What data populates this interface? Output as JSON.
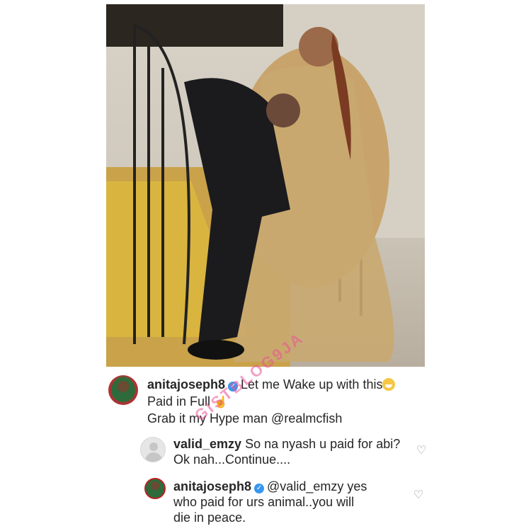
{
  "post": {
    "username": "anitajoseph8",
    "caption_line1": "Let me Wake up with this",
    "caption_line2": "Paid in Full",
    "caption_line3": "Grab it my Hype man @realmcfish"
  },
  "comments": [
    {
      "username": "valid_emzy",
      "text_line1": "So na nyash u paid for abi?",
      "text_line2": "Ok nah...Continue...."
    },
    {
      "username": "anitajoseph8",
      "text_line1": "@valid_emzy yes",
      "text_line2": "who paid for urs animal..you will",
      "text_line3": "die in peace."
    }
  ],
  "watermark": "GISTBLOG9JA",
  "colors": {
    "verified": "#3897f0",
    "watermark": "#e95096",
    "text": "#262626"
  },
  "icons": [
    "verified-icon",
    "heart-icon",
    "smile-emoji",
    "pointing-emoji",
    "default-avatar-icon"
  ]
}
